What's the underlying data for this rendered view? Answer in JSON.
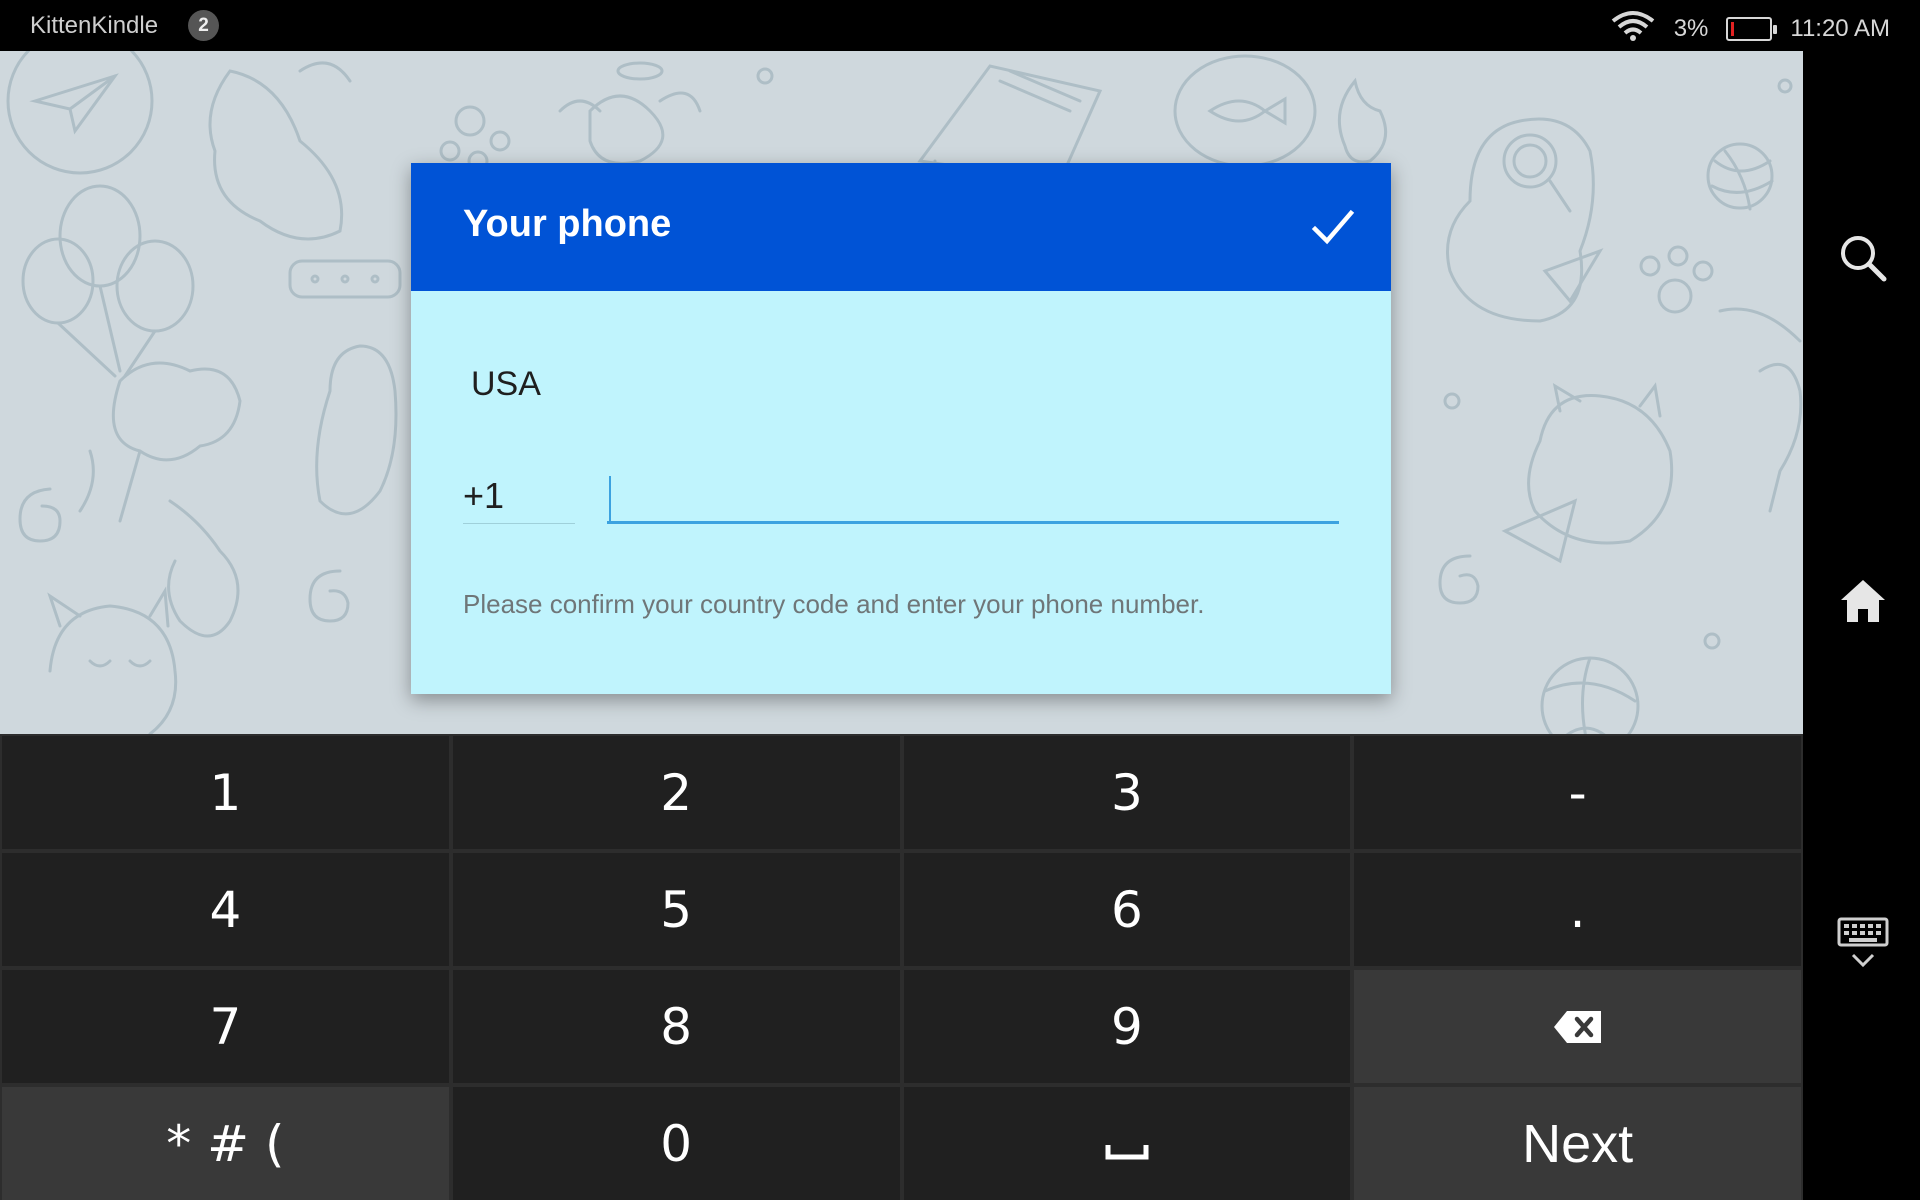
{
  "status_bar": {
    "app_name": "KittenKindle",
    "notification_count": "2",
    "battery_percent": "3%",
    "battery_level": 0.03,
    "time": "11:20 AM"
  },
  "dialog": {
    "title": "Your phone",
    "country": "USA",
    "country_code": "+1",
    "phone_value": "",
    "hint": "Please confirm your country code and enter your phone number."
  },
  "keyboard": {
    "keys": [
      {
        "label": "1",
        "name": "key-1"
      },
      {
        "label": "2",
        "name": "key-2"
      },
      {
        "label": "3",
        "name": "key-3"
      },
      {
        "label": "-",
        "name": "key-dash"
      },
      {
        "label": "4",
        "name": "key-4"
      },
      {
        "label": "5",
        "name": "key-5"
      },
      {
        "label": "6",
        "name": "key-6"
      },
      {
        "label": ".",
        "name": "key-period"
      },
      {
        "label": "7",
        "name": "key-7"
      },
      {
        "label": "8",
        "name": "key-8"
      },
      {
        "label": "9",
        "name": "key-9"
      },
      {
        "label": "",
        "name": "backspace-key",
        "icon": "backspace-icon"
      },
      {
        "label": "* # (",
        "name": "symbols-key"
      },
      {
        "label": "0",
        "name": "key-0"
      },
      {
        "label": "",
        "name": "space-key",
        "icon": "space-icon"
      },
      {
        "label": "Next",
        "name": "next-key"
      }
    ]
  },
  "nav": {
    "icons": [
      "search-icon",
      "home-icon",
      "keyboard-hide-icon"
    ]
  },
  "colors": {
    "header_blue": "#0053d6",
    "dialog_bg": "#c0f4fd",
    "input_underline": "#3ca2e0",
    "background": "#cfd8dd",
    "key_bg": "#202020",
    "key_alt_bg": "#393939",
    "battery_low": "#e22222"
  }
}
